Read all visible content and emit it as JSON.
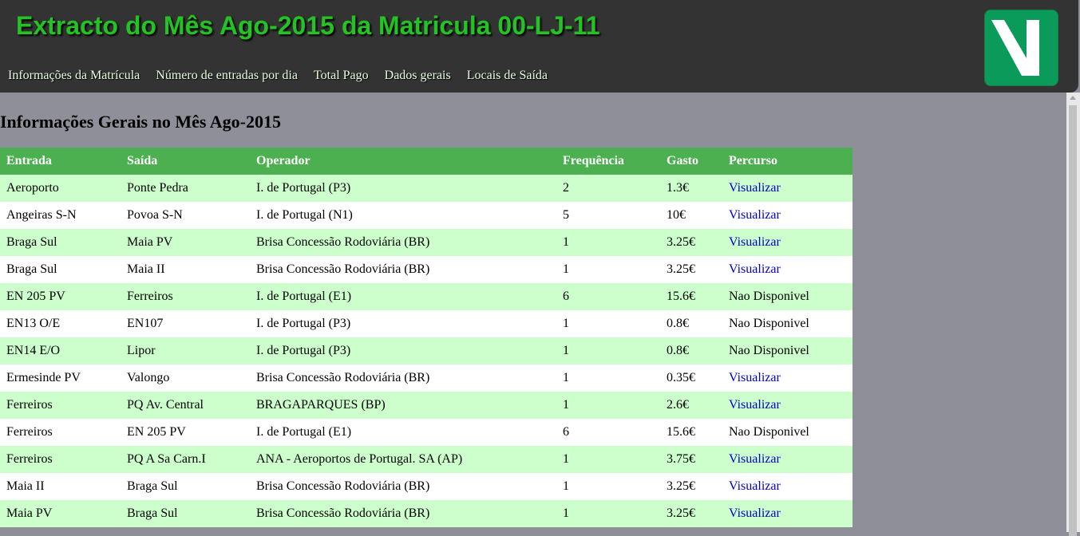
{
  "header": {
    "title": "Extracto do Mês Ago-2015 da Matricula 00-LJ-11",
    "nav": [
      "Informações da Matrícula",
      "Número de entradas por dia",
      "Total Pago",
      "Dados gerais",
      "Locais de Saída"
    ],
    "logo_icon": "via-verde-logo-icon"
  },
  "main": {
    "section_title": "Informações Gerais no Mês Ago-2015",
    "columns": [
      "Entrada",
      "Saída",
      "Operador",
      "Frequência",
      "Gasto",
      "Percurso"
    ],
    "rows": [
      {
        "entrada": "Aeroporto",
        "saida": "Ponte Pedra",
        "operador": "I. de Portugal (P3)",
        "frequencia": "2",
        "gasto": "1.3€",
        "percurso": "Visualizar"
      },
      {
        "entrada": "Angeiras S-N",
        "saida": "Povoa S-N",
        "operador": "I. de Portugal (N1)",
        "frequencia": "5",
        "gasto": "10€",
        "percurso": "Visualizar"
      },
      {
        "entrada": "Braga Sul",
        "saida": "Maia PV",
        "operador": "Brisa Concessão Rodoviária (BR)",
        "frequencia": "1",
        "gasto": "3.25€",
        "percurso": "Visualizar"
      },
      {
        "entrada": "Braga Sul",
        "saida": "Maia II",
        "operador": "Brisa Concessão Rodoviária (BR)",
        "frequencia": "1",
        "gasto": "3.25€",
        "percurso": "Visualizar"
      },
      {
        "entrada": "EN 205 PV",
        "saida": "Ferreiros",
        "operador": "I. de Portugal (E1)",
        "frequencia": "6",
        "gasto": "15.6€",
        "percurso": "Nao Disponivel"
      },
      {
        "entrada": "EN13 O/E",
        "saida": "EN107",
        "operador": "I. de Portugal (P3)",
        "frequencia": "1",
        "gasto": "0.8€",
        "percurso": "Nao Disponivel"
      },
      {
        "entrada": "EN14 E/O",
        "saida": "Lipor",
        "operador": "I. de Portugal (P3)",
        "frequencia": "1",
        "gasto": "0.8€",
        "percurso": "Nao Disponivel"
      },
      {
        "entrada": "Ermesinde PV",
        "saida": "Valongo",
        "operador": "Brisa Concessão Rodoviária (BR)",
        "frequencia": "1",
        "gasto": "0.35€",
        "percurso": "Visualizar"
      },
      {
        "entrada": "Ferreiros",
        "saida": "PQ Av. Central",
        "operador": "BRAGAPARQUES (BP)",
        "frequencia": "1",
        "gasto": "2.6€",
        "percurso": "Visualizar"
      },
      {
        "entrada": "Ferreiros",
        "saida": "EN 205 PV",
        "operador": "I. de Portugal (E1)",
        "frequencia": "6",
        "gasto": "15.6€",
        "percurso": "Nao Disponivel"
      },
      {
        "entrada": "Ferreiros",
        "saida": "PQ A Sa Carn.I",
        "operador": "ANA - Aeroportos de Portugal. SA (AP)",
        "frequencia": "1",
        "gasto": "3.75€",
        "percurso": "Visualizar"
      },
      {
        "entrada": "Maia II",
        "saida": "Braga Sul",
        "operador": "Brisa Concessão Rodoviária (BR)",
        "frequencia": "1",
        "gasto": "3.25€",
        "percurso": "Visualizar"
      },
      {
        "entrada": "Maia PV",
        "saida": "Braga Sul",
        "operador": "Brisa Concessão Rodoviária (BR)",
        "frequencia": "1",
        "gasto": "3.25€",
        "percurso": "Visualizar"
      }
    ]
  },
  "colors": {
    "header_bg": "#333333",
    "title": "#22c322",
    "table_header": "#4caf50",
    "row_odd": "#ccffcc",
    "row_even": "#ffffff",
    "link": "#0000cc",
    "page_bg": "#8f8f9a",
    "logo_bg": "#0a9a5a"
  }
}
